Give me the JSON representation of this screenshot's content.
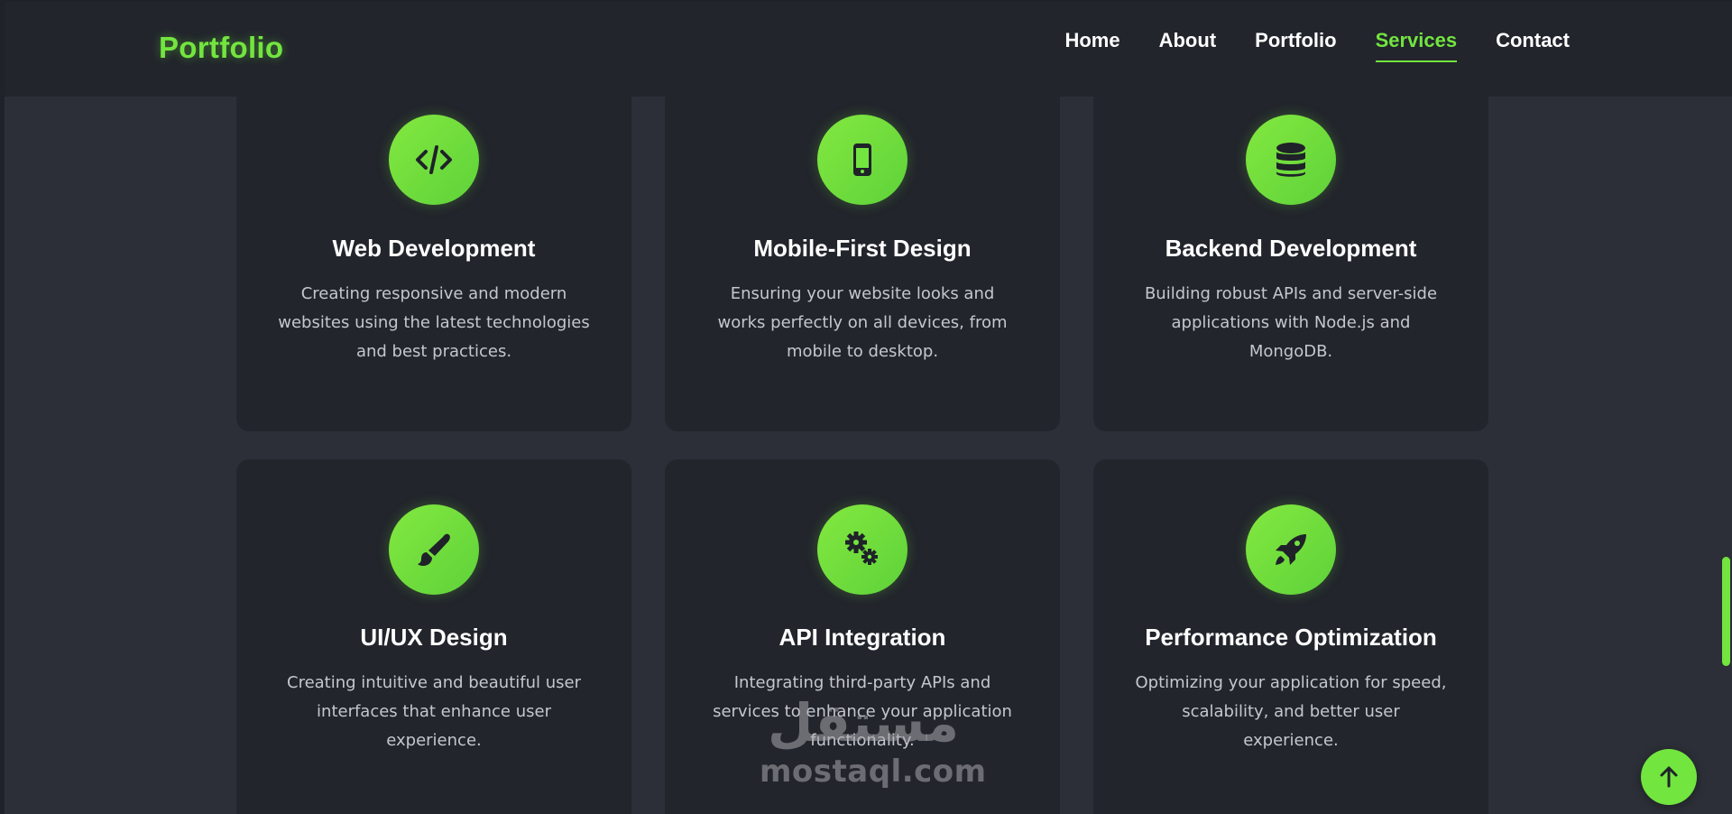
{
  "brand": "Portfolio",
  "nav": {
    "items": [
      {
        "label": "Home",
        "active": false
      },
      {
        "label": "About",
        "active": false
      },
      {
        "label": "Portfolio",
        "active": false
      },
      {
        "label": "Services",
        "active": true
      },
      {
        "label": "Contact",
        "active": false
      }
    ]
  },
  "services": [
    {
      "icon": "code-icon",
      "title": "Web Development",
      "description": "Creating responsive and modern websites using the latest technologies and best practices."
    },
    {
      "icon": "mobile-icon",
      "title": "Mobile-First Design",
      "description": "Ensuring your website looks and works perfectly on all devices, from mobile to desktop."
    },
    {
      "icon": "database-icon",
      "title": "Backend Development",
      "description": "Building robust APIs and server-side applications with Node.js and MongoDB."
    },
    {
      "icon": "paint-brush-icon",
      "title": "UI/UX Design",
      "description": "Creating intuitive and beautiful user interfaces that enhance user experience."
    },
    {
      "icon": "cogs-icon",
      "title": "API Integration",
      "description": "Integrating third-party APIs and services to enhance your application functionality."
    },
    {
      "icon": "rocket-icon",
      "title": "Performance Optimization",
      "description": "Optimizing your application for speed, scalability, and better user experience."
    }
  ],
  "watermark": {
    "arabic": "مستقل",
    "latin": "mostaql.com"
  },
  "colors": {
    "accent": "#72e53f",
    "background": "#2c2f37",
    "card": "#22252c",
    "text_muted": "#c4c7cd"
  },
  "back_to_top_icon": "arrow-up-icon"
}
